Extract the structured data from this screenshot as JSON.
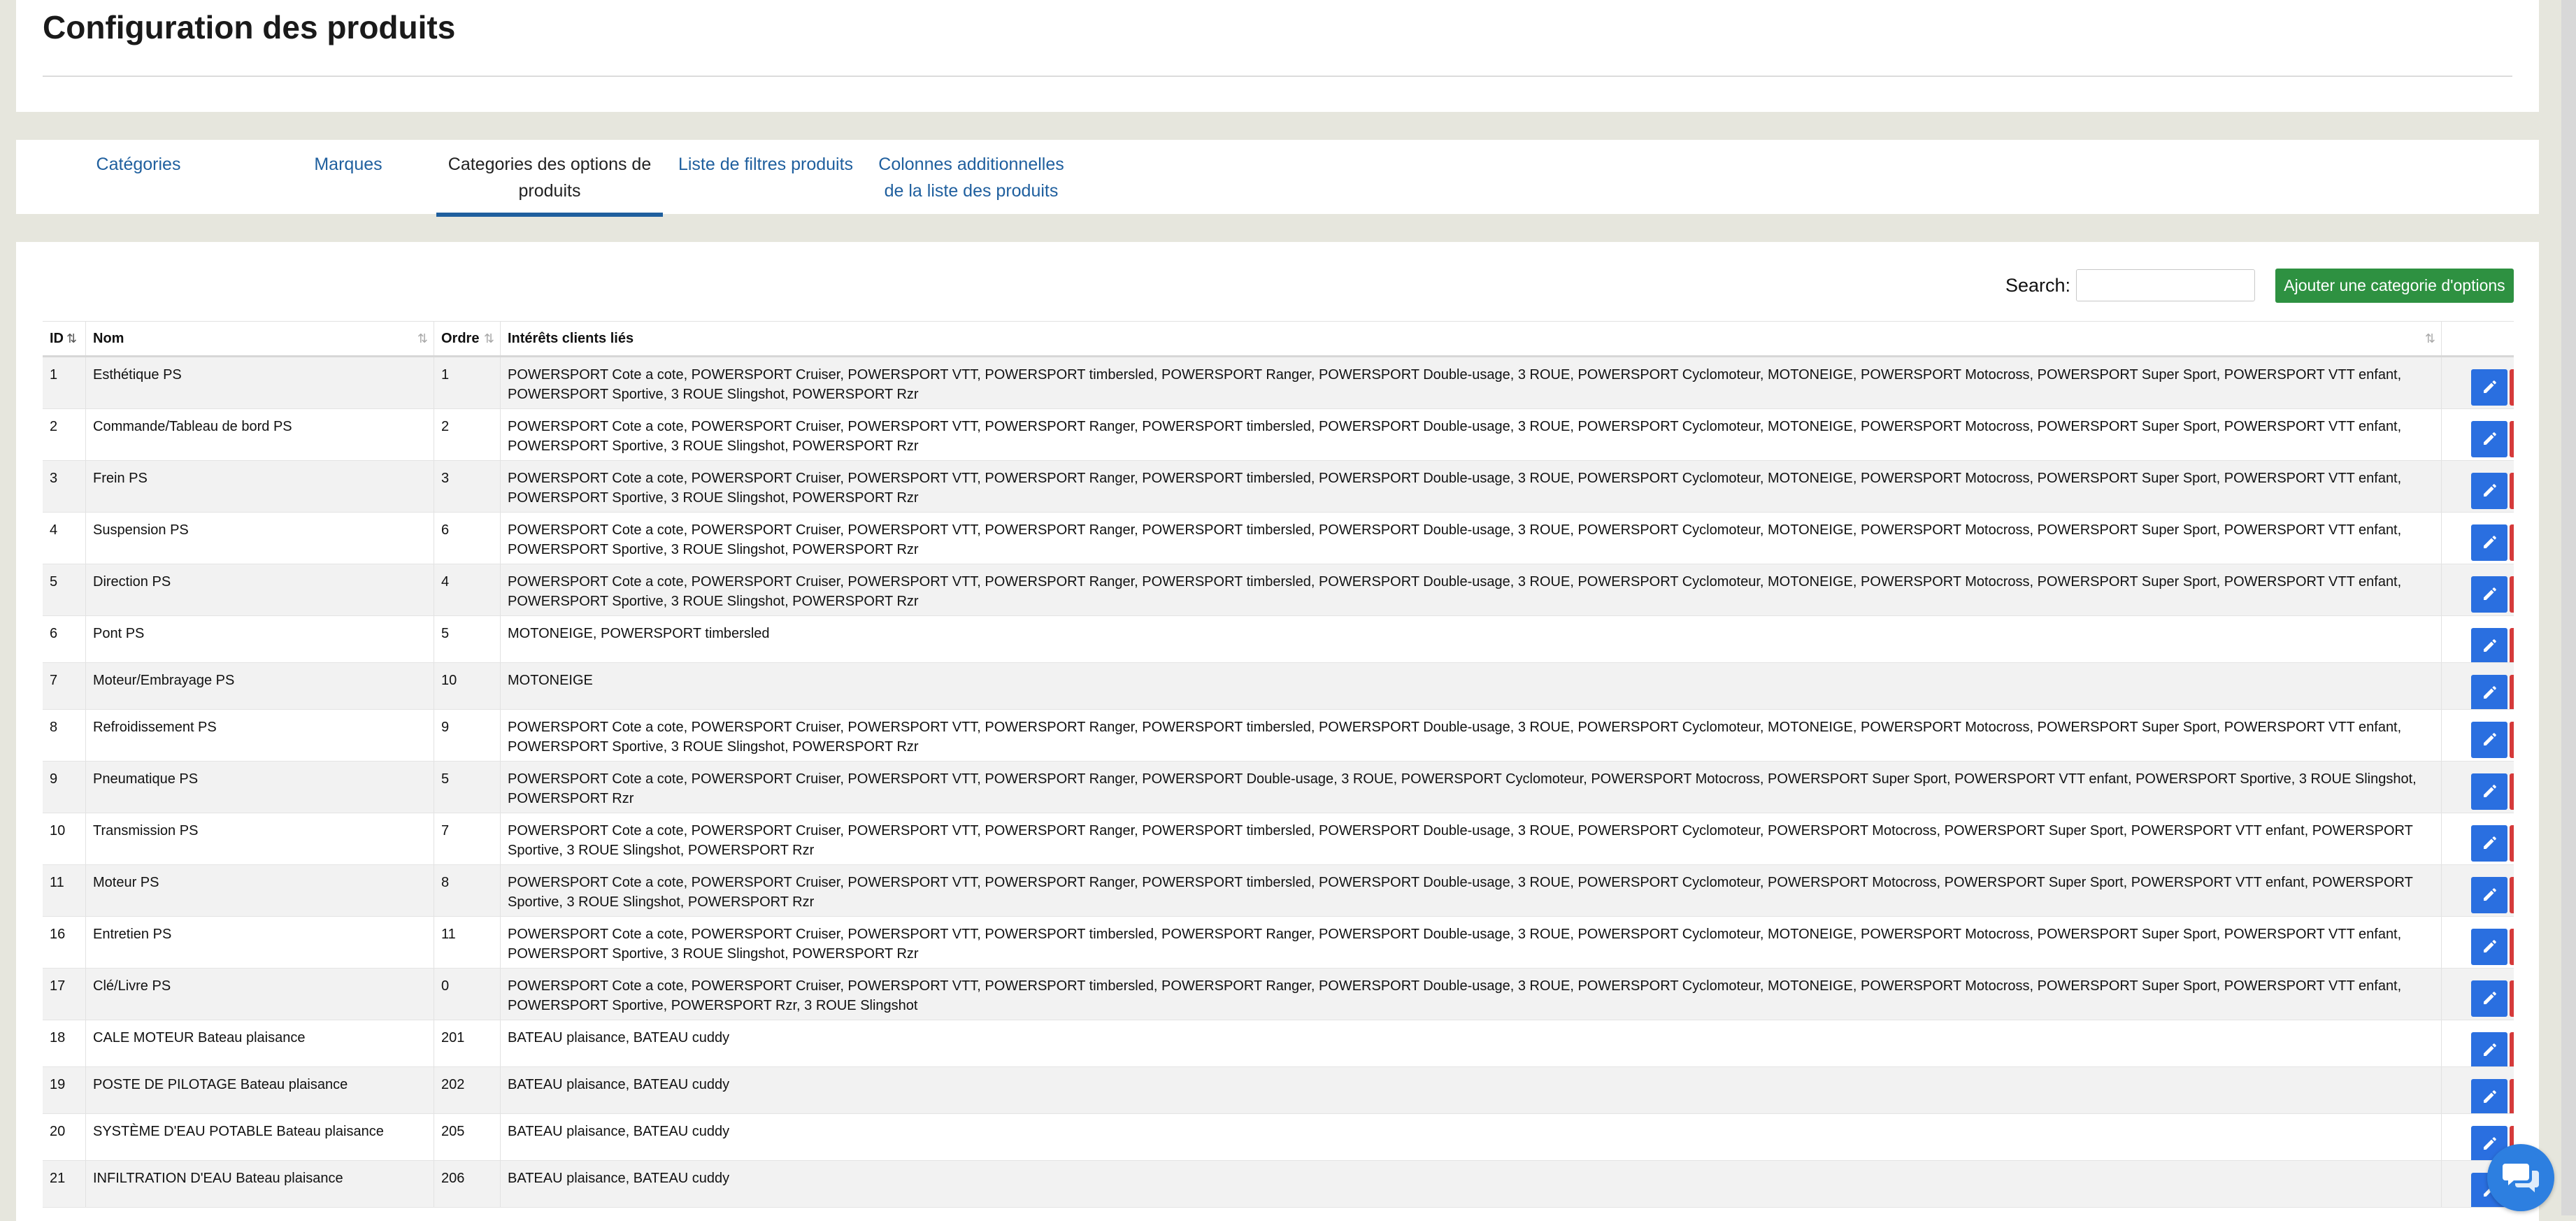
{
  "page": {
    "title": "Configuration des produits"
  },
  "tabs": [
    {
      "label": "Catégories",
      "active": false
    },
    {
      "label": "Marques",
      "active": false
    },
    {
      "label": "Categories des options de produits",
      "active": true
    },
    {
      "label": "Liste de filtres produits",
      "active": false
    },
    {
      "label": "Colonnes additionnelles de la liste des produits",
      "active": false
    }
  ],
  "toolbar": {
    "search_label": "Search:",
    "search_value": "",
    "add_button_label": "Ajouter une categorie d'options"
  },
  "table": {
    "columns": [
      {
        "label": "ID",
        "sort": "active"
      },
      {
        "label": "Nom",
        "sort": "none"
      },
      {
        "label": "Ordre",
        "sort": "none"
      },
      {
        "label": "Intérêts clients liés",
        "sort": "none"
      },
      {
        "label": "",
        "sort": "none"
      }
    ],
    "rows": [
      {
        "id": "1",
        "nom": "Esthétique PS",
        "ordre": "1",
        "interets": "POWERSPORT Cote a cote, POWERSPORT Cruiser, POWERSPORT VTT, POWERSPORT timbersled, POWERSPORT Ranger, POWERSPORT Double-usage, 3 ROUE, POWERSPORT Cyclomoteur, MOTONEIGE, POWERSPORT Motocross, POWERSPORT Super Sport, POWERSPORT VTT enfant, POWERSPORT Sportive, 3 ROUE Slingshot, POWERSPORT Rzr"
      },
      {
        "id": "2",
        "nom": "Commande/Tableau de bord PS",
        "ordre": "2",
        "interets": "POWERSPORT Cote a cote, POWERSPORT Cruiser, POWERSPORT VTT, POWERSPORT Ranger, POWERSPORT timbersled, POWERSPORT Double-usage, 3 ROUE, POWERSPORT Cyclomoteur, MOTONEIGE, POWERSPORT Motocross, POWERSPORT Super Sport, POWERSPORT VTT enfant, POWERSPORT Sportive, 3 ROUE Slingshot, POWERSPORT Rzr"
      },
      {
        "id": "3",
        "nom": "Frein PS",
        "ordre": "3",
        "interets": "POWERSPORT Cote a cote, POWERSPORT Cruiser, POWERSPORT VTT, POWERSPORT Ranger, POWERSPORT timbersled, POWERSPORT Double-usage, 3 ROUE, POWERSPORT Cyclomoteur, MOTONEIGE, POWERSPORT Motocross, POWERSPORT Super Sport, POWERSPORT VTT enfant, POWERSPORT Sportive, 3 ROUE Slingshot, POWERSPORT Rzr"
      },
      {
        "id": "4",
        "nom": "Suspension PS",
        "ordre": "6",
        "interets": "POWERSPORT Cote a cote, POWERSPORT Cruiser, POWERSPORT VTT, POWERSPORT Ranger, POWERSPORT timbersled, POWERSPORT Double-usage, 3 ROUE, POWERSPORT Cyclomoteur, MOTONEIGE, POWERSPORT Motocross, POWERSPORT Super Sport, POWERSPORT VTT enfant, POWERSPORT Sportive, 3 ROUE Slingshot, POWERSPORT Rzr"
      },
      {
        "id": "5",
        "nom": "Direction PS",
        "ordre": "4",
        "interets": "POWERSPORT Cote a cote, POWERSPORT Cruiser, POWERSPORT VTT, POWERSPORT Ranger, POWERSPORT timbersled, POWERSPORT Double-usage, 3 ROUE, POWERSPORT Cyclomoteur, MOTONEIGE, POWERSPORT Motocross, POWERSPORT Super Sport, POWERSPORT VTT enfant, POWERSPORT Sportive, 3 ROUE Slingshot, POWERSPORT Rzr"
      },
      {
        "id": "6",
        "nom": "Pont PS",
        "ordre": "5",
        "interets": "MOTONEIGE, POWERSPORT timbersled"
      },
      {
        "id": "7",
        "nom": "Moteur/Embrayage PS",
        "ordre": "10",
        "interets": "MOTONEIGE"
      },
      {
        "id": "8",
        "nom": "Refroidissement PS",
        "ordre": "9",
        "interets": "POWERSPORT Cote a cote, POWERSPORT Cruiser, POWERSPORT VTT, POWERSPORT Ranger, POWERSPORT timbersled, POWERSPORT Double-usage, 3 ROUE, POWERSPORT Cyclomoteur, MOTONEIGE, POWERSPORT Motocross, POWERSPORT Super Sport, POWERSPORT VTT enfant, POWERSPORT Sportive, 3 ROUE Slingshot, POWERSPORT Rzr"
      },
      {
        "id": "9",
        "nom": "Pneumatique PS",
        "ordre": "5",
        "interets": "POWERSPORT Cote a cote, POWERSPORT Cruiser, POWERSPORT VTT, POWERSPORT Ranger, POWERSPORT Double-usage, 3 ROUE, POWERSPORT Cyclomoteur, POWERSPORT Motocross, POWERSPORT Super Sport, POWERSPORT VTT enfant, POWERSPORT Sportive, 3 ROUE Slingshot, POWERSPORT Rzr"
      },
      {
        "id": "10",
        "nom": "Transmission PS",
        "ordre": "7",
        "interets": "POWERSPORT Cote a cote, POWERSPORT Cruiser, POWERSPORT VTT, POWERSPORT Ranger, POWERSPORT timbersled, POWERSPORT Double-usage, 3 ROUE, POWERSPORT Cyclomoteur, POWERSPORT Motocross, POWERSPORT Super Sport, POWERSPORT VTT enfant, POWERSPORT Sportive, 3 ROUE Slingshot, POWERSPORT Rzr"
      },
      {
        "id": "11",
        "nom": "Moteur PS",
        "ordre": "8",
        "interets": "POWERSPORT Cote a cote, POWERSPORT Cruiser, POWERSPORT VTT, POWERSPORT Ranger, POWERSPORT timbersled, POWERSPORT Double-usage, 3 ROUE, POWERSPORT Cyclomoteur, POWERSPORT Motocross, POWERSPORT Super Sport, POWERSPORT VTT enfant, POWERSPORT Sportive, 3 ROUE Slingshot, POWERSPORT Rzr"
      },
      {
        "id": "16",
        "nom": "Entretien PS",
        "ordre": "11",
        "interets": "POWERSPORT Cote a cote, POWERSPORT Cruiser, POWERSPORT VTT, POWERSPORT timbersled, POWERSPORT Ranger, POWERSPORT Double-usage, 3 ROUE, POWERSPORT Cyclomoteur, MOTONEIGE, POWERSPORT Motocross, POWERSPORT Super Sport, POWERSPORT VTT enfant, POWERSPORT Sportive, 3 ROUE Slingshot, POWERSPORT Rzr"
      },
      {
        "id": "17",
        "nom": "Clé/Livre PS",
        "ordre": "0",
        "interets": "POWERSPORT Cote a cote, POWERSPORT Cruiser, POWERSPORT VTT, POWERSPORT timbersled, POWERSPORT Ranger, POWERSPORT Double-usage, 3 ROUE, POWERSPORT Cyclomoteur, MOTONEIGE, POWERSPORT Motocross, POWERSPORT Super Sport, POWERSPORT VTT enfant, POWERSPORT Sportive, POWERSPORT Rzr, 3 ROUE Slingshot"
      },
      {
        "id": "18",
        "nom": "CALE MOTEUR Bateau plaisance",
        "ordre": "201",
        "interets": "BATEAU plaisance, BATEAU cuddy"
      },
      {
        "id": "19",
        "nom": "POSTE DE PILOTAGE Bateau plaisance",
        "ordre": "202",
        "interets": "BATEAU plaisance, BATEAU cuddy"
      },
      {
        "id": "20",
        "nom": "SYSTÈME D'EAU POTABLE Bateau plaisance",
        "ordre": "205",
        "interets": "BATEAU plaisance, BATEAU cuddy"
      },
      {
        "id": "21",
        "nom": "INFILTRATION D'EAU Bateau plaisance",
        "ordre": "206",
        "interets": "BATEAU plaisance, BATEAU cuddy"
      }
    ]
  },
  "icons": {
    "edit": "pencil-icon",
    "delete": "trash-icon",
    "sort": "sort-arrows-icon",
    "chat": "chat-icon"
  },
  "colors": {
    "link": "#1f5f9e",
    "add_button": "#2e9141",
    "edit_button": "#2a6fe0",
    "delete_button": "#d53a3a",
    "chat_bubble": "#2d7fe0"
  }
}
